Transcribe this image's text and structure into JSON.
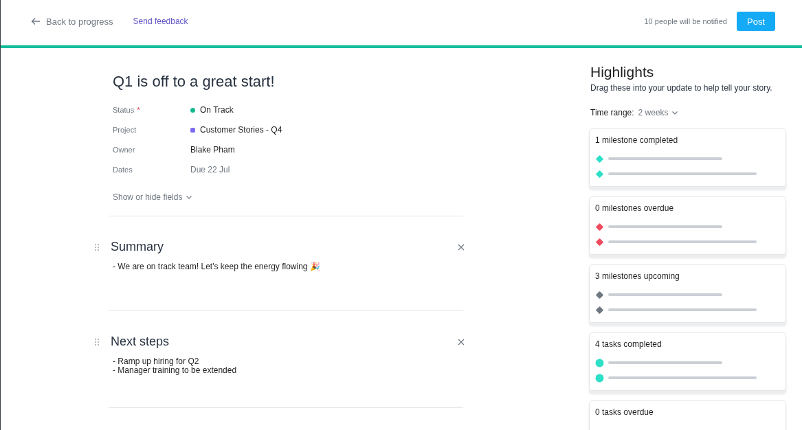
{
  "header": {
    "back_link": "Back to progress",
    "feedback_link": "Send feedback",
    "notify_text": "10 people will be notified",
    "post_button": "Post"
  },
  "update": {
    "title": "Q1 is off to a great start!",
    "fields": [
      {
        "label": "Status",
        "required_mark": "*",
        "value": "On Track",
        "kind": "dot",
        "color": "#14b88f"
      },
      {
        "label": "Project",
        "value": "Customer Stories - Q4",
        "kind": "square",
        "color": "#7b6cf0"
      },
      {
        "label": "Owner",
        "value": "Blake Pham"
      },
      {
        "label": "Dates",
        "value": "Due 22 Jul",
        "muted": true
      }
    ],
    "toggle_fields": "Show or hide fields",
    "sections": [
      {
        "title": "Summary",
        "lines": [
          "- We are on track team! Let's keep the energy flowing 🎉"
        ]
      },
      {
        "title": "Next steps",
        "lines": [
          "- Ramp up hiring for Q2",
          "- Manager training to be extended"
        ]
      }
    ]
  },
  "highlights": {
    "title": "Highlights",
    "subtitle": "Drag these into your update to help tell your story.",
    "time_range_label": "Time range:",
    "time_range_value": "2 weeks",
    "cards": [
      {
        "title": "1 milestone completed",
        "kind": "diamond",
        "color": "#2de0c7"
      },
      {
        "title": "0 milestones overdue",
        "kind": "diamond",
        "color": "#ef4a5d"
      },
      {
        "title": "3 milestones upcoming",
        "kind": "diamond",
        "color": "#6f7782"
      },
      {
        "title": "4 tasks completed",
        "kind": "circle",
        "color": "#2de0c7"
      },
      {
        "title": "0 tasks overdue"
      }
    ]
  }
}
